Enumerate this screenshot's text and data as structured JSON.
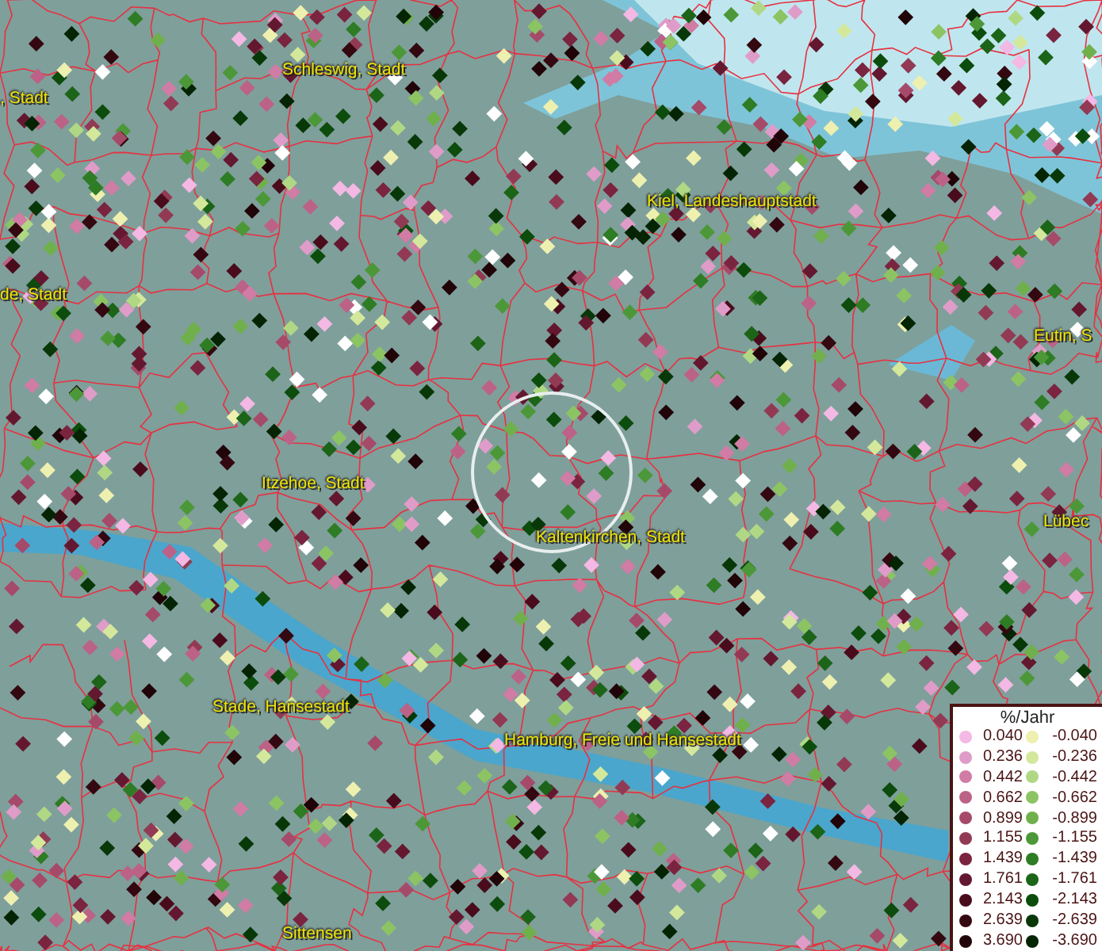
{
  "map": {
    "labels": [
      {
        "text": "Schleswig, Stadt"
      },
      {
        "text": ", Stadt"
      },
      {
        "text": "de, Stadt"
      },
      {
        "text": "Kiel, Landeshauptstadt"
      },
      {
        "text": "Eutin, S"
      },
      {
        "text": "Itzehoe, Stadt"
      },
      {
        "text": "Kaltenkirchen, Stadt"
      },
      {
        "text": "Lübec"
      },
      {
        "text": "Stade, Hansestadt"
      },
      {
        "text": "Hamburg, Freie und Hansestadt"
      },
      {
        "text": "Sittensen"
      }
    ]
  },
  "legend": {
    "title": "%/Jahr",
    "positive": [
      {
        "label": "0.040",
        "color": "#f4b8e4"
      },
      {
        "label": "0.236",
        "color": "#e09cc8"
      },
      {
        "label": "0.442",
        "color": "#d07ca4"
      },
      {
        "label": "0.662",
        "color": "#bc6286"
      },
      {
        "label": "0.899",
        "color": "#a64a6a"
      },
      {
        "label": "1.155",
        "color": "#923a54"
      },
      {
        "label": "1.439",
        "color": "#7a2440"
      },
      {
        "label": "1.761",
        "color": "#641830"
      },
      {
        "label": "2.143",
        "color": "#4a0c1c"
      },
      {
        "label": "2.639",
        "color": "#340810"
      },
      {
        "label": "3.690",
        "color": "#200408"
      }
    ],
    "negative": [
      {
        "label": "-0.040",
        "color": "#eef0b0"
      },
      {
        "label": "-0.236",
        "color": "#d4e89c"
      },
      {
        "label": "-0.442",
        "color": "#b0d884"
      },
      {
        "label": "-0.662",
        "color": "#8cc464"
      },
      {
        "label": "-0.899",
        "color": "#70b04c"
      },
      {
        "label": "-1.155",
        "color": "#4c9838"
      },
      {
        "label": "-1.439",
        "color": "#2e7c24"
      },
      {
        "label": "-1.761",
        "color": "#1c6418"
      },
      {
        "label": "-2.143",
        "color": "#0c4c0c"
      },
      {
        "label": "-2.639",
        "color": "#083808"
      },
      {
        "label": "-3.690",
        "color": "#042404"
      }
    ]
  }
}
